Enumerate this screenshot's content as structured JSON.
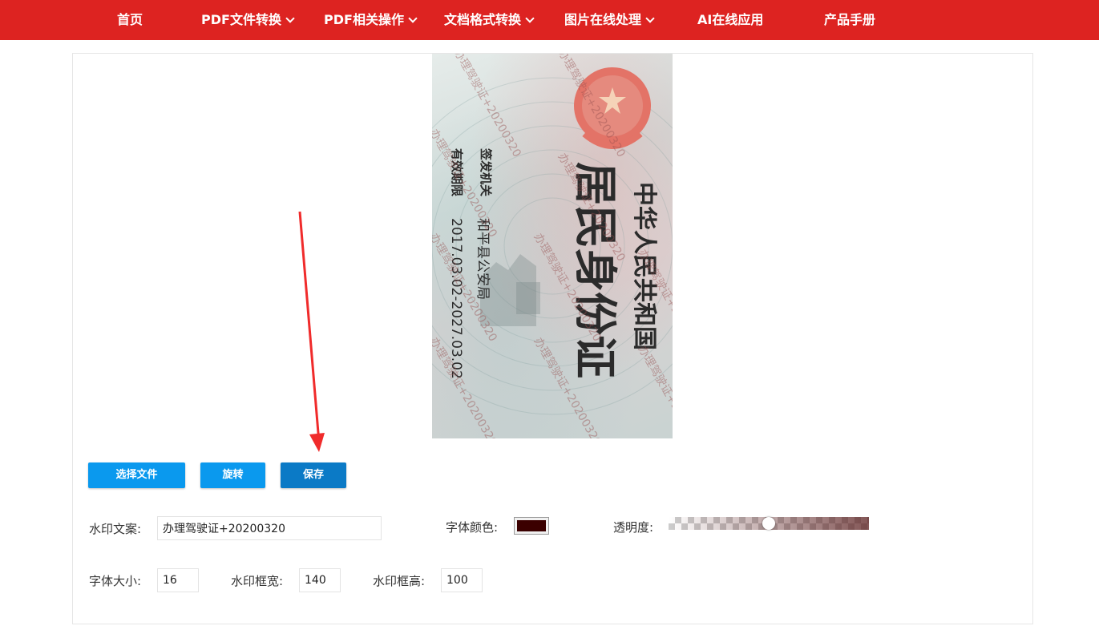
{
  "nav": {
    "items": [
      {
        "label": "首页",
        "has_dropdown": false
      },
      {
        "label": "PDF文件转换",
        "has_dropdown": true
      },
      {
        "label": "PDF相关操作",
        "has_dropdown": true
      },
      {
        "label": "文档格式转换",
        "has_dropdown": true
      },
      {
        "label": "图片在线处理",
        "has_dropdown": true
      },
      {
        "label": "AI在线应用",
        "has_dropdown": false
      },
      {
        "label": "产品手册",
        "has_dropdown": false
      }
    ]
  },
  "preview": {
    "card_title_line1": "中华人民共和国",
    "card_title_line2": "居民身份证",
    "issuer_label": "签发机关",
    "issuer_value": "和平县公安局",
    "valid_label": "有效期限",
    "valid_value": "2017.03.02-2027.03.02",
    "watermark_text": "办理驾驶证+20200320"
  },
  "toolbar": {
    "choose_file_label": "选择文件",
    "rotate_label": "旋转",
    "save_label": "保存"
  },
  "settings": {
    "watermark_text_label": "水印文案:",
    "watermark_text_value": "办理驾驶证+20200320",
    "font_color_label": "字体颜色:",
    "font_color_value": "#3b0000",
    "opacity_label": "透明度:",
    "opacity_value": 0.5,
    "font_size_label": "字体大小:",
    "font_size_value": "16",
    "box_width_label": "水印框宽:",
    "box_width_value": "140",
    "box_height_label": "水印框高:",
    "box_height_value": "100"
  },
  "colors": {
    "nav_bg": "#dd2321",
    "button_blue": "#0a99ee",
    "button_dark": "#0b7ac6",
    "arrow": "#f02b2b"
  }
}
